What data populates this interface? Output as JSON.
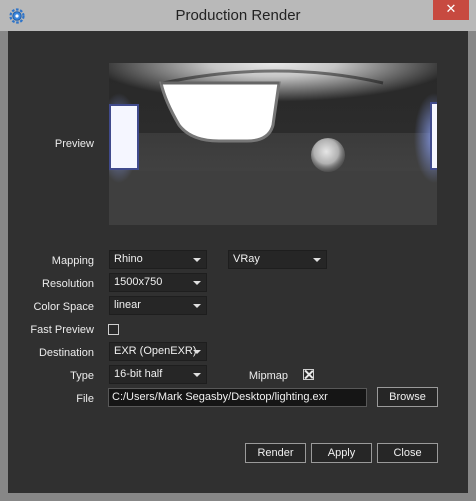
{
  "window": {
    "title": "Production Render",
    "close_glyph": "✕",
    "app_icon": "gear-icon"
  },
  "preview": {
    "label": "Preview"
  },
  "mapping": {
    "label": "Mapping",
    "value": "Rhino",
    "renderer": "VRay"
  },
  "resolution": {
    "label": "Resolution",
    "value": "1500x750"
  },
  "color_space": {
    "label": "Color Space",
    "value": "linear"
  },
  "fast_preview": {
    "label": "Fast Preview",
    "checked": false
  },
  "destination": {
    "label": "Destination",
    "value": "EXR (OpenEXR)"
  },
  "type": {
    "label": "Type",
    "value": "16-bit half"
  },
  "mipmap": {
    "label": "Mipmap",
    "checked": true
  },
  "file": {
    "label": "File",
    "value": "C:/Users/Mark Segasby/Desktop/lighting.exr",
    "browse": "Browse"
  },
  "buttons": {
    "render": "Render",
    "apply": "Apply",
    "close": "Close"
  },
  "colors": {
    "titlebar": "#b9b9b9",
    "client_bg": "#303030",
    "close_red": "#c74a40"
  }
}
